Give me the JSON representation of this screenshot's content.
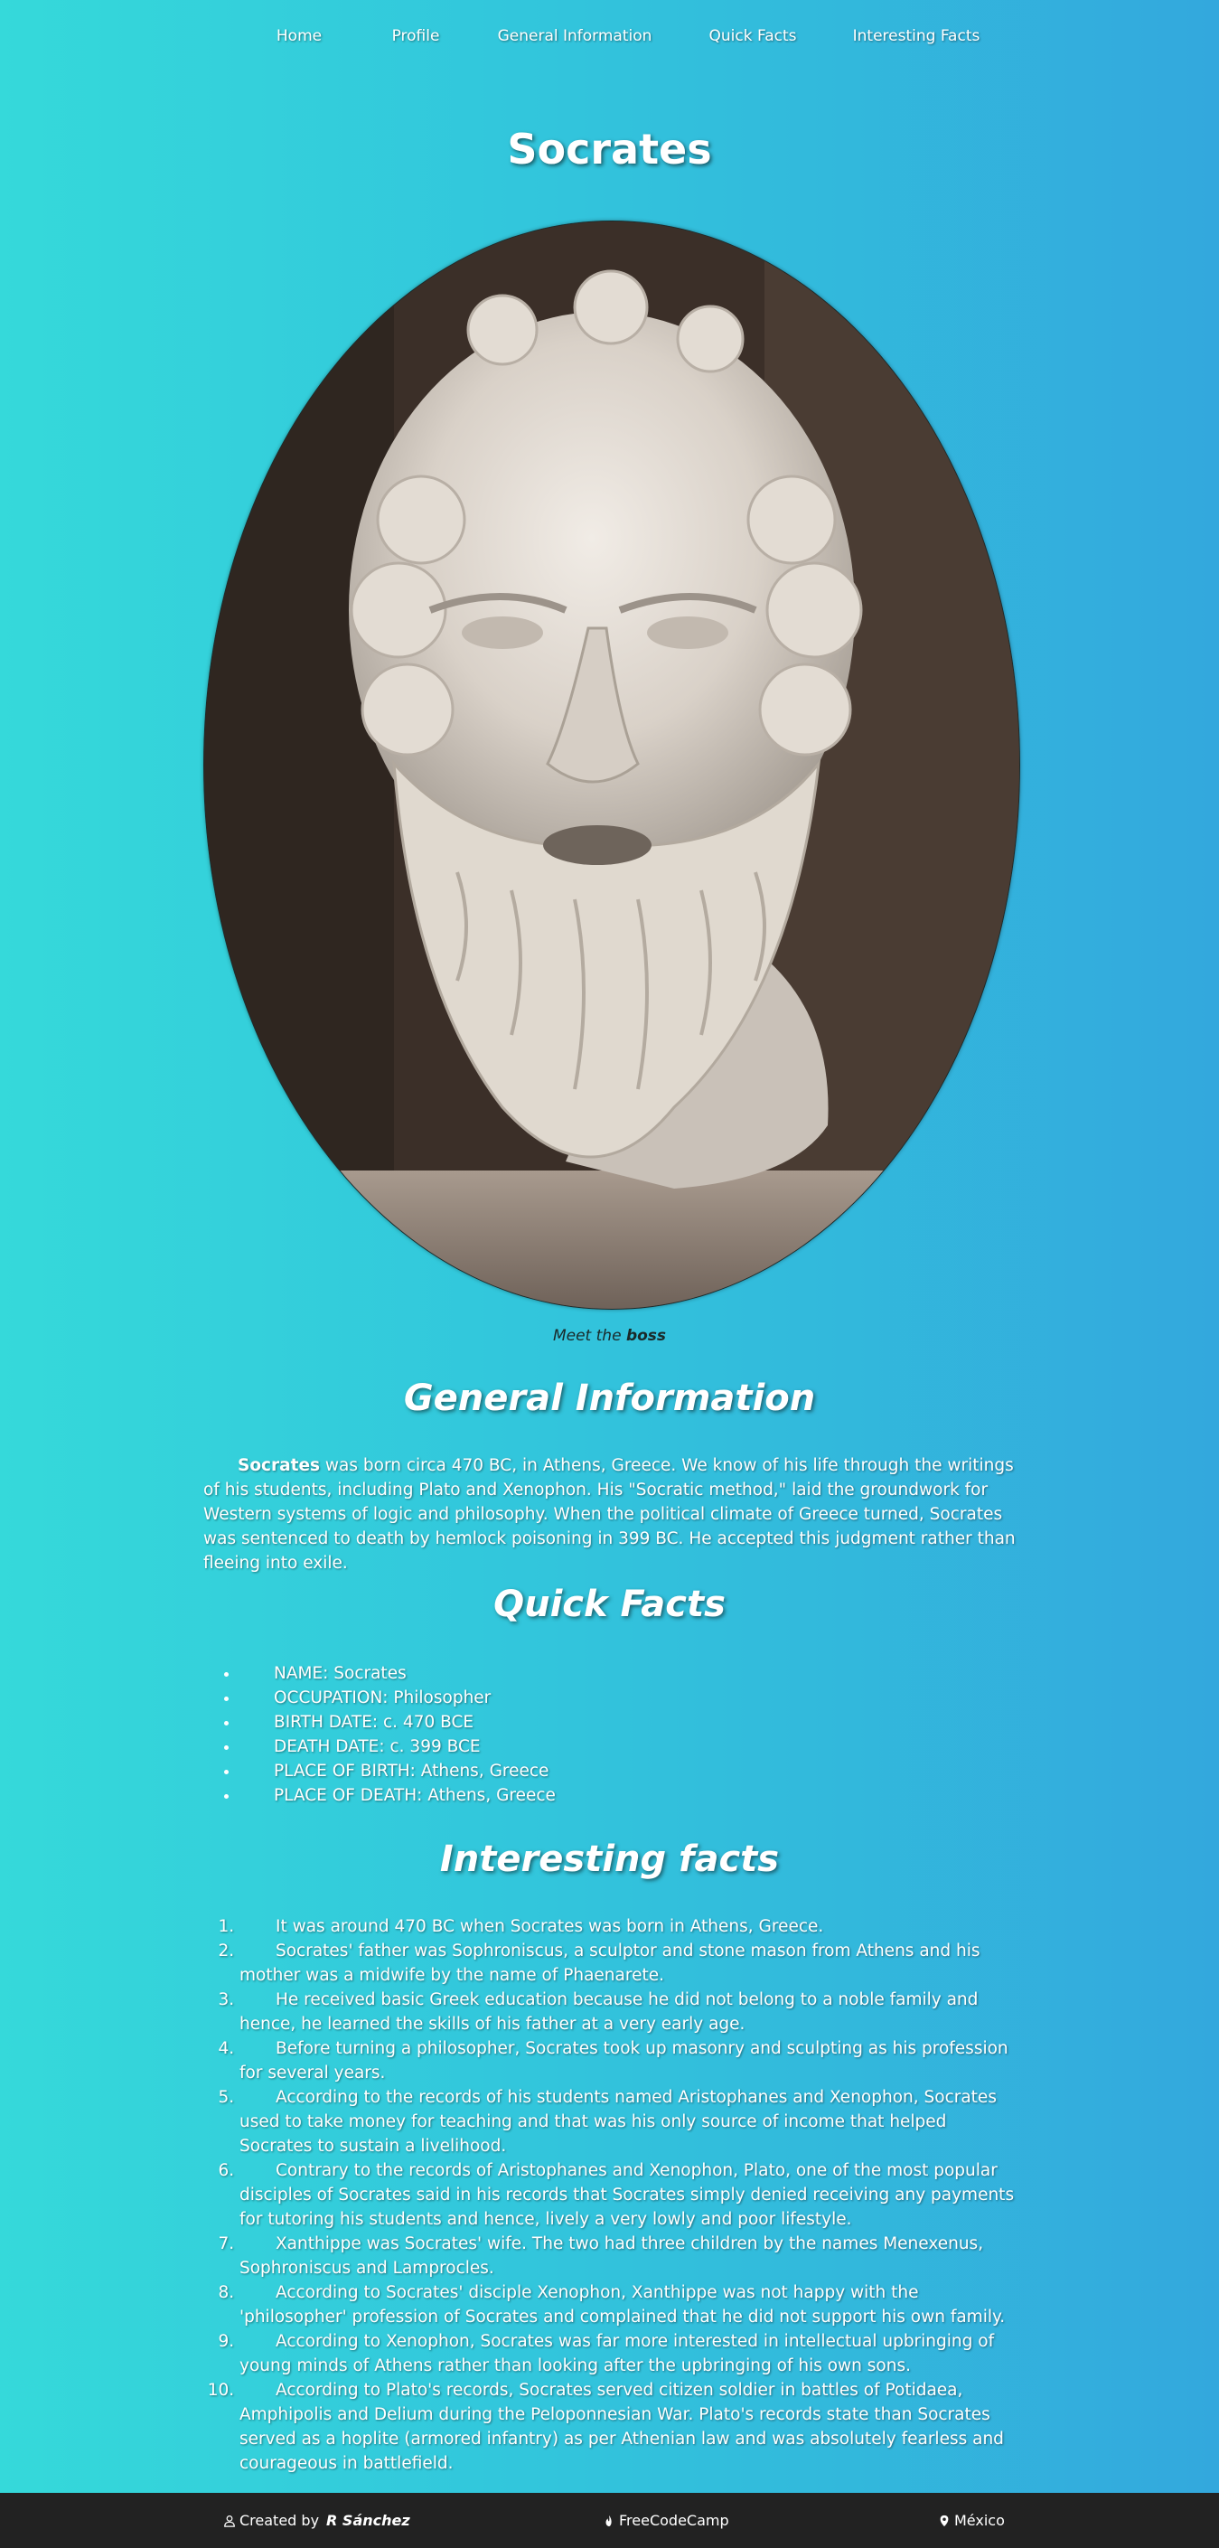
{
  "nav": {
    "items": [
      "Home",
      "Profile",
      "General Information",
      "Quick Facts",
      "Interesting Facts"
    ]
  },
  "header": {
    "title": "Socrates"
  },
  "image": {
    "caption_prefix": "Meet the",
    "caption_bold": "boss"
  },
  "general": {
    "title": "General Information",
    "lead_bold": "Socrates",
    "body": " was born circa 470 BC, in Athens, Greece. We know of his life through the writings of his students, including Plato and Xenophon. His \"Socratic method,\" laid the groundwork for Western systems of logic and philosophy. When the political climate of Greece turned, Socrates was sentenced to death by hemlock poisoning in 399 BC. He accepted this judgment rather than fleeing into exile."
  },
  "quick_facts": {
    "title": "Quick Facts",
    "items": [
      "NAME: Socrates",
      "OCCUPATION: Philosopher",
      "BIRTH DATE: c. 470 BCE",
      "DEATH DATE: c. 399 BCE",
      "PLACE OF BIRTH: Athens, Greece",
      "PLACE OF DEATH: Athens, Greece"
    ]
  },
  "interesting": {
    "title": "Interesting facts",
    "items": [
      "It was around 470 BC when Socrates was born in Athens, Greece.",
      "Socrates' father was Sophroniscus, a sculptor and stone mason from Athens and his mother was a midwife by the name of Phaenarete.",
      "He received basic Greek education because he did not belong to a noble family and hence, he learned the skills of his father at a very early age.",
      "Before turning a philosopher, Socrates took up masonry and sculpting as his profession for several years.",
      "According to the records of his students named Aristophanes and Xenophon, Socrates used to take money for teaching and that was his only source of income that helped Socrates to sustain a livelihood.",
      "Contrary to the records of Aristophanes and Xenophon, Plato, one of the most popular disciples of Socrates said in his records that Socrates simply denied receiving any payments for tutoring his students and hence, lively a very lowly and poor lifestyle.",
      "Xanthippe was Socrates' wife. The two had three children by the names Menexenus, Sophroniscus and Lamprocles.",
      "According to Socrates' disciple Xenophon, Xanthippe was not happy with the 'philosopher' profession of Socrates and complained that he did not support his own family.",
      "According to Xenophon, Socrates was far more interested in intellectual upbringing of young minds of Athens rather than looking after the upbringing of his own sons.",
      "According to Plato's records, Socrates served citizen soldier in battles of Potidaea, Amphipolis and Delium during the Peloponnesian War. Plato's records state than Socrates served as a hoplite (armored infantry) as per Athenian law and was absolutely fearless and courageous in battlefield."
    ]
  },
  "footer": {
    "created_by": "Created by",
    "author": "R Sánchez",
    "platform": "FreeCodeCamp",
    "location": "México",
    "icons": [
      "user-icon",
      "flame-icon",
      "map-pin-icon"
    ]
  },
  "colors": {
    "gradient_start": "#35d9da",
    "gradient_end": "#33a8dd",
    "footer_bg": "#222222",
    "caption_text": "#1a2a2a"
  }
}
